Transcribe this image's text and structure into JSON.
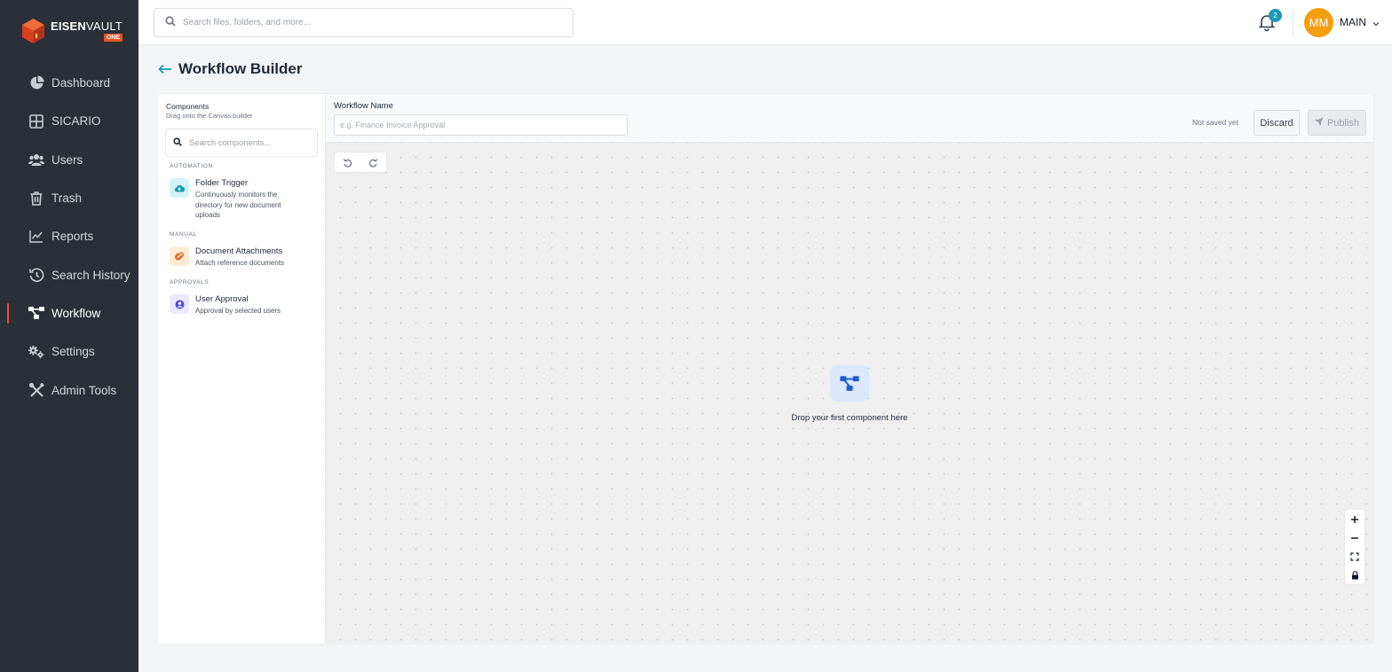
{
  "brand": {
    "name_bold": "EISEN",
    "name_light": "VAULT",
    "tag": "ONE"
  },
  "search": {
    "placeholder": "Search files, folders, and more..."
  },
  "notifications": {
    "count": "2"
  },
  "user": {
    "initials": "MM",
    "name": "MAIN"
  },
  "sidebar": {
    "items": [
      {
        "label": "Dashboard",
        "icon": "pie-chart-icon"
      },
      {
        "label": "SICARIO",
        "icon": "grid-icon"
      },
      {
        "label": "Users",
        "icon": "users-icon"
      },
      {
        "label": "Trash",
        "icon": "trash-icon"
      },
      {
        "label": "Reports",
        "icon": "line-chart-icon"
      },
      {
        "label": "Search History",
        "icon": "history-icon"
      },
      {
        "label": "Workflow",
        "icon": "workflow-icon",
        "active": true
      },
      {
        "label": "Settings",
        "icon": "gears-icon"
      },
      {
        "label": "Admin Tools",
        "icon": "tools-icon"
      }
    ]
  },
  "page": {
    "title": "Workflow Builder"
  },
  "palette": {
    "title": "Components",
    "subtitle": "Drag onto the Canvas builder",
    "search_placeholder": "Search components...",
    "groups": [
      {
        "label": "AUTOMATION",
        "components": [
          {
            "name": "Folder Trigger",
            "description": "Continuously monitors the directory for new document uploads",
            "icon": "cloud-upload-icon"
          }
        ]
      },
      {
        "label": "MANUAL",
        "components": [
          {
            "name": "Document Attachments",
            "description": "Attach reference documents",
            "icon": "paperclip-icon"
          }
        ]
      },
      {
        "label": "APPROVALS",
        "components": [
          {
            "name": "User Approval",
            "description": "Approval by selected users",
            "icon": "user-circle-icon"
          }
        ]
      }
    ]
  },
  "workflow": {
    "name_label": "Workflow Name",
    "name_placeholder": "e.g. Finance Invoice Approval",
    "name_value": "",
    "save_status": "Not saved yet",
    "discard_label": "Discard",
    "publish_label": "Publish"
  },
  "canvas": {
    "empty_message": "Drop your first component here"
  },
  "colors": {
    "accent": "#1a9bb8",
    "brand": "#e8542a",
    "sidebar_bg": "#2b3038",
    "avatar": "#f29f10"
  }
}
